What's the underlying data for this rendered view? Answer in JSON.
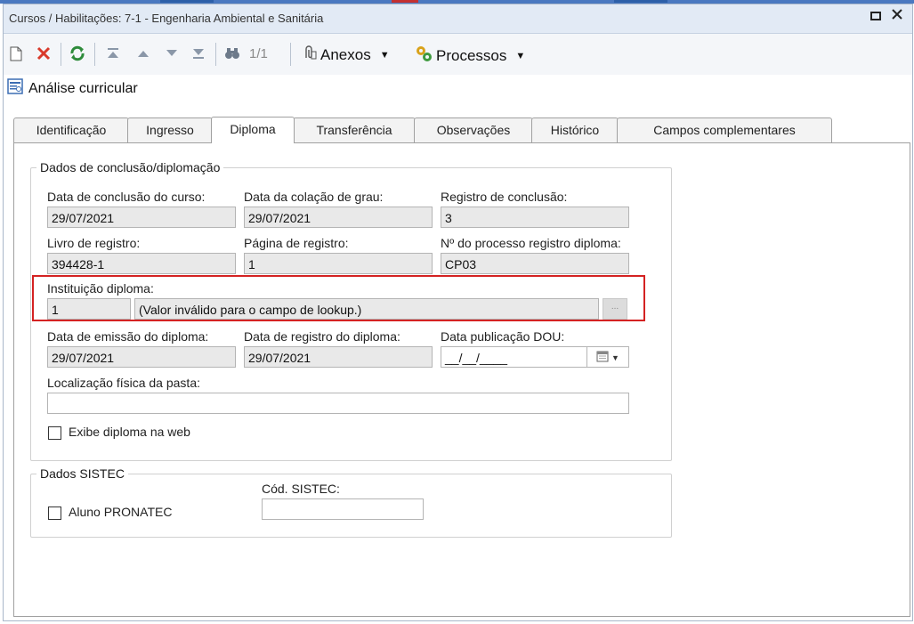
{
  "window": {
    "title": "Cursos / Habilitações: 7-1 - Engenharia Ambiental e Sanitária"
  },
  "toolbar": {
    "record_counter": "1/1",
    "anexos_label": "Anexos",
    "processos_label": "Processos"
  },
  "section": {
    "title": "Análise curricular"
  },
  "tabs": [
    {
      "label": "Identificação",
      "active": false
    },
    {
      "label": "Ingresso",
      "active": false
    },
    {
      "label": "Diploma",
      "active": true
    },
    {
      "label": "Transferência",
      "active": false
    },
    {
      "label": "Observações",
      "active": false
    },
    {
      "label": "Histórico",
      "active": false
    },
    {
      "label": "Campos complementares",
      "active": false
    }
  ],
  "conclusao": {
    "legend": "Dados de conclusão/diplomação",
    "data_conclusao_label": "Data de conclusão do curso:",
    "data_conclusao_value": "29/07/2021",
    "data_colacao_label": "Data da colação de grau:",
    "data_colacao_value": "29/07/2021",
    "registro_conclusao_label": "Registro de conclusão:",
    "registro_conclusao_value": "3",
    "livro_registro_label": "Livro de registro:",
    "livro_registro_value": "394428-1",
    "pagina_registro_label": "Página de registro:",
    "pagina_registro_value": "1",
    "processo_registro_label": "Nº do processo registro diploma:",
    "processo_registro_value": "CP03",
    "instituicao_label": "Instituição diploma:",
    "instituicao_code": "1",
    "instituicao_desc": "(Valor inválido para o campo de lookup.)",
    "lookup_button_label": "...",
    "data_emissao_label": "Data de emissão do diploma:",
    "data_emissao_value": "29/07/2021",
    "data_registro_label": "Data de registro do diploma:",
    "data_registro_value": "29/07/2021",
    "data_publicacao_label": "Data publicação DOU:",
    "data_publicacao_value": "__/__/____",
    "localizacao_label": "Localização física da pasta:",
    "localizacao_value": "",
    "exibe_web_label": "Exibe diploma na web",
    "exibe_web_checked": false
  },
  "sistec": {
    "legend": "Dados SISTEC",
    "pronatec_label": "Aluno PRONATEC",
    "pronatec_checked": false,
    "cod_sistec_label": "Cód. SISTEC:",
    "cod_sistec_value": ""
  },
  "colors": {
    "highlight_border": "#d42222",
    "title_bar": "#e2eaf5"
  }
}
